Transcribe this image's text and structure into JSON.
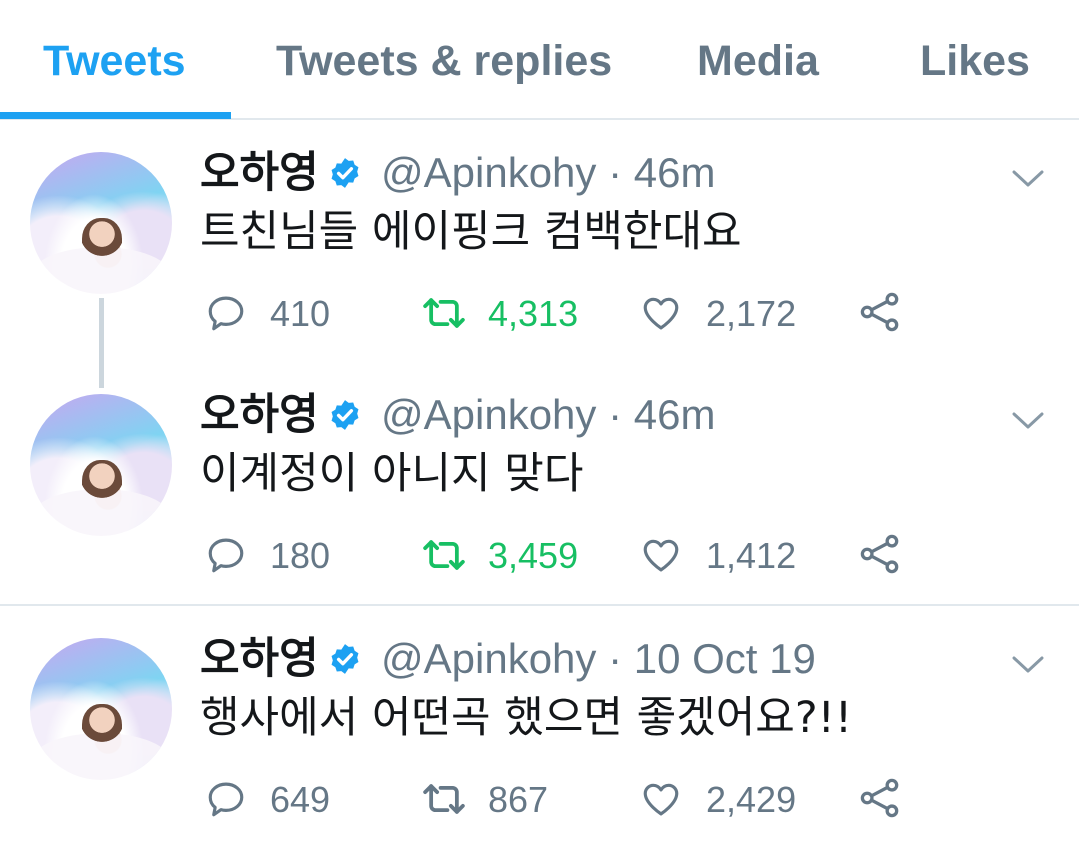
{
  "tabs": [
    {
      "label": "Tweets",
      "active": true
    },
    {
      "label": "Tweets & replies",
      "active": false
    },
    {
      "label": "Media",
      "active": false
    },
    {
      "label": "Likes",
      "active": false
    }
  ],
  "colors": {
    "accent": "#1da1f2",
    "retweet_green": "#17bf63",
    "secondary_text": "#657786",
    "divider": "#e1e8ed"
  },
  "tweets": [
    {
      "name": "오하영",
      "handle": "@Apinkohy",
      "time": "· 46m",
      "text": "트친님들 에이핑크 컴백한대요",
      "replies": "410",
      "retweets": "4,313",
      "retweeted": true,
      "likes": "2,172"
    },
    {
      "name": "오하영",
      "handle": "@Apinkohy",
      "time": "· 46m",
      "text": "이계정이 아니지 맞다",
      "replies": "180",
      "retweets": "3,459",
      "retweeted": true,
      "likes": "1,412"
    },
    {
      "name": "오하영",
      "handle": "@Apinkohy",
      "time": "· 10 Oct 19",
      "text": "행사에서 어떤곡 했으면 좋겠어요?!!",
      "replies": "649",
      "retweets": "867",
      "retweeted": false,
      "likes": "2,429"
    }
  ],
  "icons": {
    "verified": "verified-badge-icon",
    "chevron": "chevron-down-icon",
    "reply": "reply-icon",
    "retweet": "retweet-icon",
    "like": "heart-icon",
    "share": "share-icon"
  }
}
